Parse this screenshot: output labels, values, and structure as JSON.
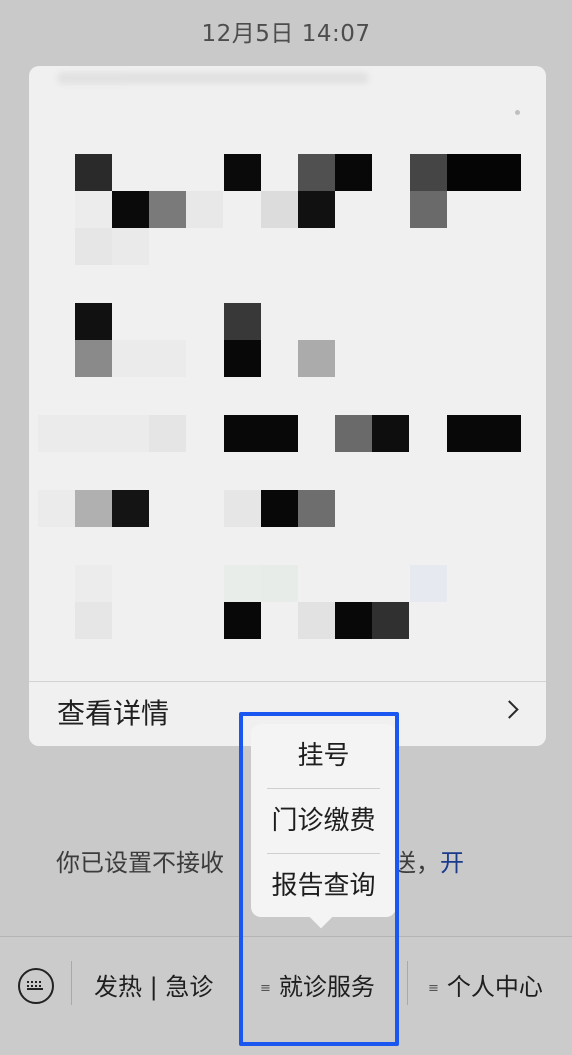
{
  "status": {
    "time": "12月5日 14:07"
  },
  "card": {
    "footer_label": "查看详情"
  },
  "notice": {
    "text": "你已设置不接收",
    "text_tail": "章推送，",
    "link": "开"
  },
  "popup_menu": {
    "items": [
      "挂号",
      "门诊缴费",
      "报告查询"
    ]
  },
  "menu_bar": {
    "keyboard_icon": "keyboard-icon",
    "items": [
      {
        "label": "发热 | 急诊",
        "has_submenu": false
      },
      {
        "label": "就诊服务",
        "has_submenu": true
      },
      {
        "label": "个人中心",
        "has_submenu": true
      }
    ]
  },
  "colors": {
    "highlight": "#1a56f0",
    "link": "#1a3a8a",
    "background": "#c9c9c9"
  }
}
